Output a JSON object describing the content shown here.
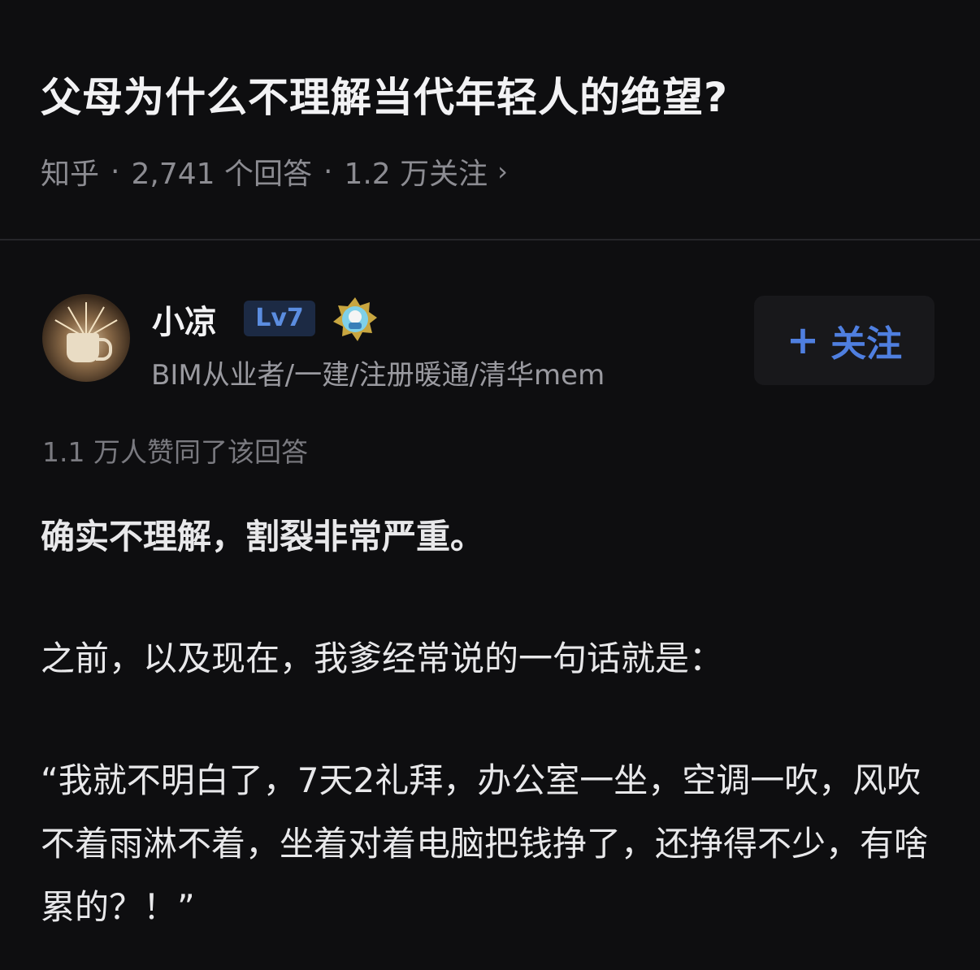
{
  "question": {
    "title": "父母为什么不理解当代年轻人的绝望?",
    "source": "知乎",
    "separator": "·",
    "answers_count": "2,741 个回答",
    "followers_count": "1.2 万关注",
    "chevron": "›"
  },
  "answer": {
    "author": {
      "name": "小凉",
      "level": "Lv7",
      "bio": "BIM从业者/一建/注册暖通/清华mem",
      "avatar_icon": "avatar-coffee-cup",
      "medal_icon": "medal-icon"
    },
    "follow_button": {
      "plus": "+",
      "label": "关注"
    },
    "upvotes": "1.1 万人赞同了该回答",
    "paragraphs": [
      "确实不理解，割裂非常严重。",
      "之前，以及现在，我爹经常说的一句话就是：",
      "“我就不明白了，7天2礼拜，办公室一坐，空调一吹，风吹不着雨淋不着，坐着对着电脑把钱挣了，还挣得不少，有啥累的？！”"
    ]
  },
  "colors": {
    "background": "#0e0e10",
    "accent": "#4f7fe0",
    "level_badge_bg": "#1c2a44",
    "muted_text": "#8c8c92"
  }
}
